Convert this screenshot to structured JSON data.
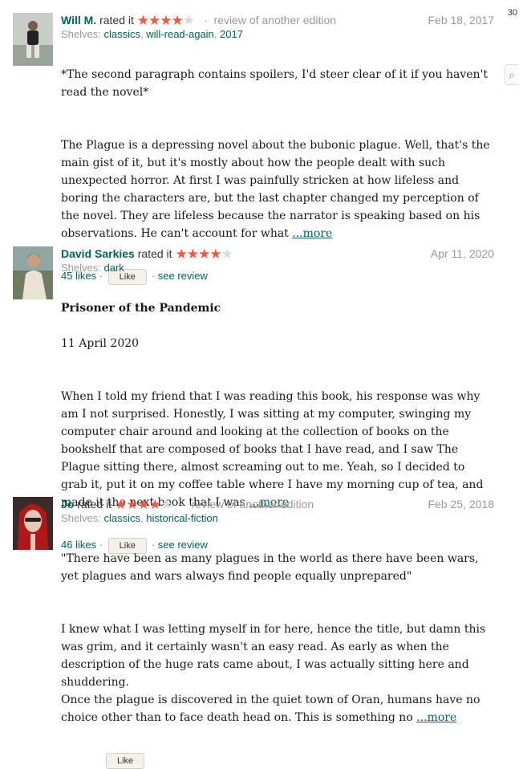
{
  "edge": {
    "number": "30",
    "icon": "search-icon"
  },
  "reviews": [
    {
      "user": "Will M.",
      "rated_label": "rated it",
      "rating": 4,
      "edition_note": "review of another edition",
      "date": "Feb 18, 2017",
      "shelves_label": "Shelves:",
      "shelves": [
        "classics",
        "will-read-again",
        "2017"
      ],
      "title": "",
      "subtitle": "",
      "paragraphs": [
        "*The second paragraph contains spoilers, I'd steer clear of it if you haven't read the novel*",
        "The Plague is a depressing novel about the bubonic plague. Well, that's the main gist of it, but it's mostly about how the people dealt with such unexpected horror. At first I was painfully stricken at how lifeless and boring the characters are, but the last chapter changed my perception of the novel. They are lifeless because the narrator is speaking based on his observations. He can't account for what"
      ],
      "more": "...more",
      "likes": "45 likes",
      "like_button": "Like",
      "see_review": "see review"
    },
    {
      "user": "David Sarkies",
      "rated_label": "rated it",
      "rating": 4,
      "edition_note": "",
      "date": "Apr 11, 2020",
      "shelves_label": "Shelves:",
      "shelves": [
        "dark"
      ],
      "title": "Prisoner of the Pandemic",
      "subtitle": "11 April 2020",
      "paragraphs": [
        "When I told my friend that I was reading this book, his response was why am I not surprised. Honestly, I was sitting at my computer, swinging my computer chair around and looking at the collection of books on the bookshelf that are composed of books that I have read, and I saw The Plague sitting there, almost screaming out to me. Yeah, so I decided to grab it, put it on my coffee table where I have my morning cup of tea, and made it the next book that I was"
      ],
      "more": "...more",
      "likes": "46 likes",
      "like_button": "Like",
      "see_review": "see review"
    },
    {
      "user": "Jo",
      "rated_label": "rated it",
      "rating": 4,
      "edition_note": "review of another edition",
      "date": "Feb 25, 2018",
      "shelves_label": "Shelves:",
      "shelves": [
        "classics",
        "historical-fiction"
      ],
      "title": "",
      "subtitle": "",
      "paragraphs": [
        "\"There have been as many plagues in the world as there have been wars, yet plagues and wars always find people equally unprepared\"",
        "I knew what I was letting myself in for here, hence the title, but damn this was grim, and it certainly wasn't an easy read. As early as when the description of the huge rats came about, I was actually sitting here and shuddering.\nOnce the plague is discovered in the quiet town of Oran, humans have no choice other than to face death head on. This is something no"
      ],
      "more": "...more",
      "likes": "",
      "like_button": "Like",
      "see_review": ""
    }
  ],
  "colors": {
    "link": "#00635d",
    "star": "#f8553f",
    "muted": "#999999"
  }
}
